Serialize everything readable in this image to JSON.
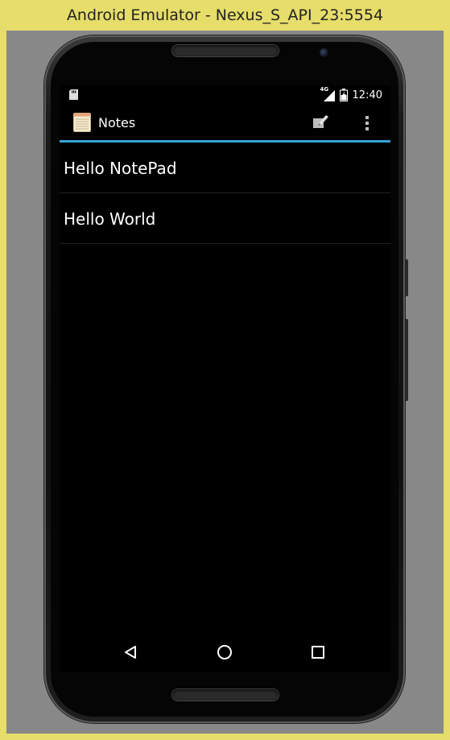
{
  "window": {
    "title": "Android Emulator - Nexus_S_API_23:5554"
  },
  "status_bar": {
    "time": "12:40",
    "network_label": "4G",
    "icons": [
      "sd-card-icon",
      "signal-icon",
      "battery-icon"
    ]
  },
  "action_bar": {
    "app_title": "Notes",
    "app_icon": "notepad-icon",
    "compose_icon": "compose-icon",
    "overflow_icon": "overflow-menu-icon",
    "accent_color": "#33a3d6"
  },
  "notes": [
    {
      "title": "Hello NotePad"
    },
    {
      "title": "Hello World"
    }
  ],
  "nav_bar": {
    "icons": [
      "back-icon",
      "home-icon",
      "recents-icon"
    ]
  }
}
